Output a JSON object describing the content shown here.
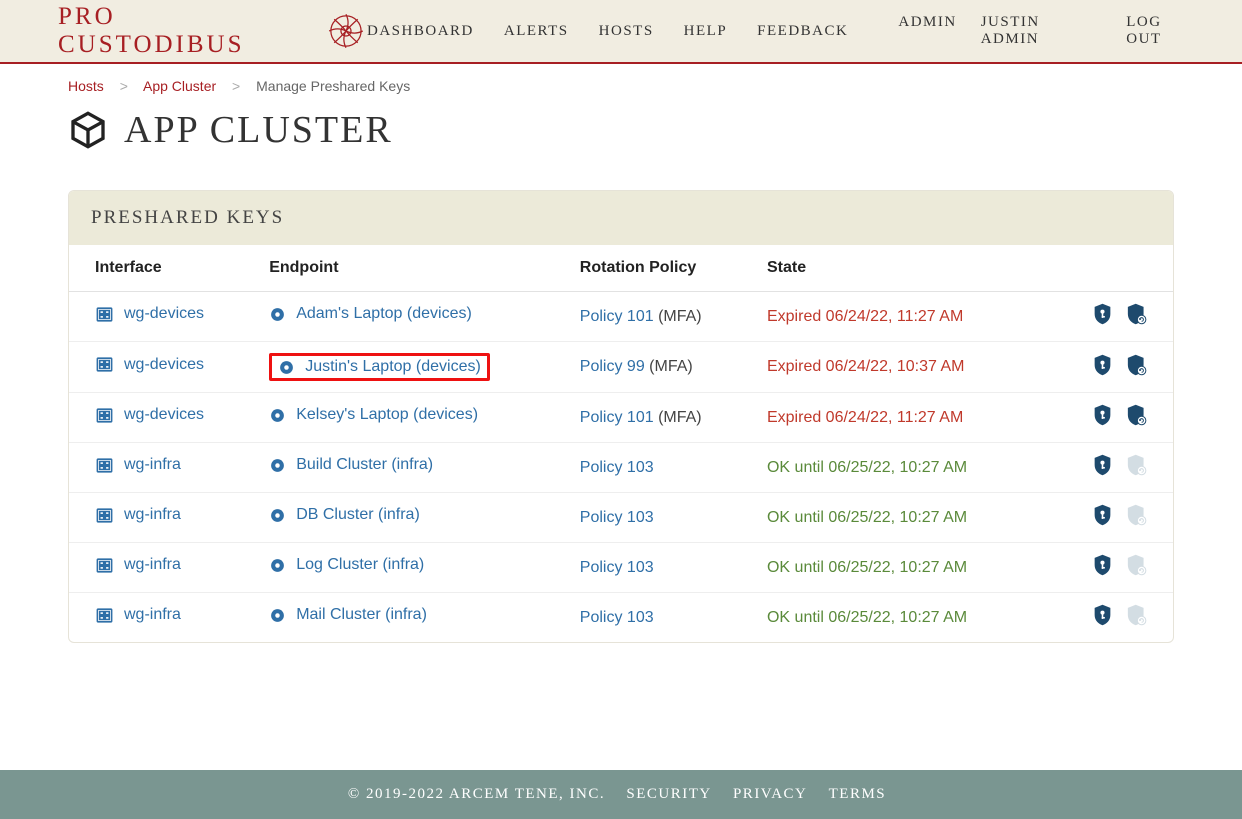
{
  "brand": "PRO CUSTODIBUS",
  "nav": {
    "dashboard": "DASHBOARD",
    "alerts": "ALERTS",
    "hosts": "HOSTS",
    "help": "HELP",
    "feedback": "FEEDBACK"
  },
  "usernav": {
    "admin": "ADMIN",
    "user": "JUSTIN ADMIN",
    "logout": "LOG OUT"
  },
  "crumbs": {
    "hosts": "Hosts",
    "cluster": "App Cluster",
    "current": "Manage Preshared Keys"
  },
  "title": "APP CLUSTER",
  "panel_title": "PRESHARED KEYS",
  "cols": {
    "iface": "Interface",
    "ep": "Endpoint",
    "policy": "Rotation Policy",
    "state": "State"
  },
  "mfa_suffix": " (MFA)",
  "rows": [
    {
      "iface": "wg-devices",
      "ep": "Adam's Laptop (devices)",
      "policy": "Policy 101",
      "mfa": true,
      "state": "Expired 06/24/22, 11:27 AM",
      "ok": false,
      "rotate_enabled": true,
      "hl": false
    },
    {
      "iface": "wg-devices",
      "ep": "Justin's Laptop (devices)",
      "policy": "Policy 99",
      "mfa": true,
      "state": "Expired 06/24/22, 10:37 AM",
      "ok": false,
      "rotate_enabled": true,
      "hl": true
    },
    {
      "iface": "wg-devices",
      "ep": "Kelsey's Laptop (devices)",
      "policy": "Policy 101",
      "mfa": true,
      "state": "Expired 06/24/22, 11:27 AM",
      "ok": false,
      "rotate_enabled": true,
      "hl": false
    },
    {
      "iface": "wg-infra",
      "ep": "Build Cluster (infra)",
      "policy": "Policy 103",
      "mfa": false,
      "state": "OK until 06/25/22, 10:27 AM",
      "ok": true,
      "rotate_enabled": false,
      "hl": false
    },
    {
      "iface": "wg-infra",
      "ep": "DB Cluster (infra)",
      "policy": "Policy 103",
      "mfa": false,
      "state": "OK until 06/25/22, 10:27 AM",
      "ok": true,
      "rotate_enabled": false,
      "hl": false
    },
    {
      "iface": "wg-infra",
      "ep": "Log Cluster (infra)",
      "policy": "Policy 103",
      "mfa": false,
      "state": "OK until 06/25/22, 10:27 AM",
      "ok": true,
      "rotate_enabled": false,
      "hl": false
    },
    {
      "iface": "wg-infra",
      "ep": "Mail Cluster (infra)",
      "policy": "Policy 103",
      "mfa": false,
      "state": "OK until 06/25/22, 10:27 AM",
      "ok": true,
      "rotate_enabled": false,
      "hl": false
    }
  ],
  "footer": {
    "copy": "© 2019-2022 ARCEM TENE, INC.",
    "security": "SECURITY",
    "privacy": "PRIVACY",
    "terms": "TERMS"
  }
}
